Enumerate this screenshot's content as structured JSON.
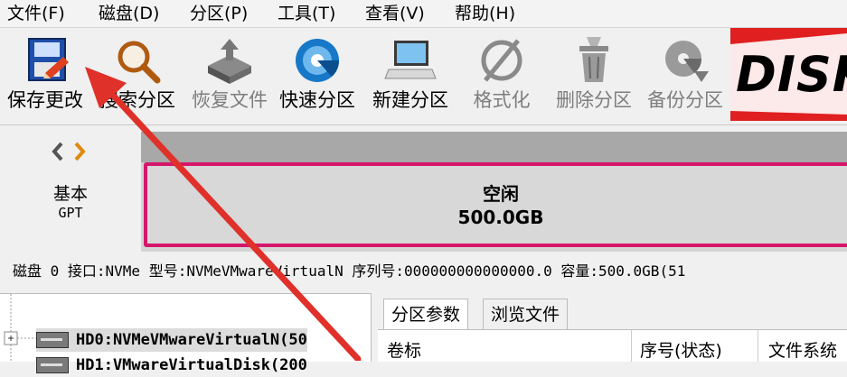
{
  "menu": [
    "文件(F)",
    "磁盘(D)",
    "分区(P)",
    "工具(T)",
    "查看(V)",
    "帮助(H)"
  ],
  "toolbar": [
    {
      "label": "保存更改",
      "icon": "save-icon",
      "enabled": true
    },
    {
      "label": "搜索分区",
      "icon": "search-icon",
      "enabled": true
    },
    {
      "label": "恢复文件",
      "icon": "recover-file-icon",
      "enabled": false
    },
    {
      "label": "快速分区",
      "icon": "quick-partition-icon",
      "enabled": true
    },
    {
      "label": "新建分区",
      "icon": "new-partition-icon",
      "enabled": true
    },
    {
      "label": "格式化",
      "icon": "format-icon",
      "enabled": false
    },
    {
      "label": "删除分区",
      "icon": "delete-partition-icon",
      "enabled": false
    },
    {
      "label": "备份分区",
      "icon": "backup-partition-icon",
      "enabled": false
    }
  ],
  "logo_text": "DISK",
  "disk_label": {
    "type": "基本",
    "scheme": "GPT"
  },
  "partition": {
    "name": "空闲",
    "size": "500.0GB"
  },
  "info_bar": "磁盘 0 接口:NVMe  型号:NVMeVMwareVirtualN  序列号:000000000000000.0  容量:500.0GB(51",
  "tree": [
    {
      "label": "HD0:NVMeVMwareVirtualN(50"
    },
    {
      "label": "HD1:VMwareVirtualDisk(200"
    }
  ],
  "tabs": [
    "分区参数",
    "浏览文件"
  ],
  "columns": [
    "卷标",
    "序号(状态)",
    "文件系统"
  ],
  "colors": {
    "accent": "#d5166a",
    "arrow": "#e0302a",
    "logo": "#e02020"
  }
}
